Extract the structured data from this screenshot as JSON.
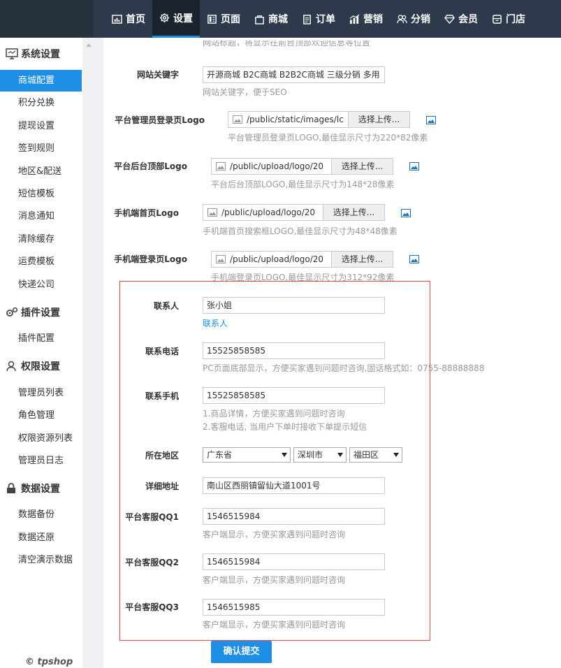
{
  "nav": {
    "items": [
      {
        "label": "首页"
      },
      {
        "label": "设置"
      },
      {
        "label": "页面"
      },
      {
        "label": "商城"
      },
      {
        "label": "订单"
      },
      {
        "label": "营销"
      },
      {
        "label": "分销"
      },
      {
        "label": "会员"
      },
      {
        "label": "门店"
      }
    ],
    "active_index": 1,
    "active_color": "#1e8de0"
  },
  "sidebar": {
    "groups": [
      {
        "title": "系统设置",
        "icon": "monitor-icon"
      },
      {
        "title": "插件设置",
        "icon": "gears-icon"
      },
      {
        "title": "权限设置",
        "icon": "user-icon"
      },
      {
        "title": "数据设置",
        "icon": "lock-icon"
      }
    ],
    "items": [
      "商城配置",
      "积分兑换",
      "提现设置",
      "签到规则",
      "地区&配送",
      "短信模板",
      "消息通知",
      "清除缓存",
      "运费模板",
      "快递公司",
      "插件配置",
      "管理员列表",
      "角色管理",
      "权限资源列表",
      "管理员日志",
      "数据备份",
      "数据还原",
      "清空演示数据"
    ],
    "active_item": "商城配置",
    "copyright": "© tpshop"
  },
  "form": {
    "top_hint_partial": "网站标题，将显示在前台顶部欢迎信息等位置",
    "keywords": {
      "label": "网站关键字",
      "value": "开源商城 B2C商城  B2B2C商城  三级分销  多用",
      "hint": "网站关键字，便于SEO"
    },
    "logos": [
      {
        "label": "平台管理员登录页Logo",
        "path": "/public/static/images/lc",
        "button": "选择上传...",
        "hint": "平台管理员登录页LOGO,最佳显示尺寸为220*82像素"
      },
      {
        "label": "平台后台顶部Logo",
        "path": "/public/upload/logo/20",
        "button": "选择上传...",
        "hint": "平台后台顶部LOGO,最佳显示尺寸为148*28像素"
      },
      {
        "label": "手机端首页Logo",
        "path": "/public/upload/logo/20",
        "button": "选择上传...",
        "hint": "手机端首页搜索框LOGO,最佳显示尺寸为48*48像素"
      },
      {
        "label": "手机端登录页Logo",
        "path": "/public/upload/logo/20",
        "button": "选择上传...",
        "hint": "手机端登录页LOGO,最佳显示尺寸为312*92像素"
      }
    ],
    "contact": {
      "label": "联系人",
      "value": "张小姐",
      "hint": "联系人"
    },
    "phone": {
      "label": "联系电话",
      "value": "15525858585",
      "hint": "PC页面底部显示，方便买家遇到问题时咨询,固话格式如：0755-88888888"
    },
    "mobile": {
      "label": "联系手机",
      "value": "15525858585",
      "hint1": "1.商品详情，方便买家遇到问题时咨询",
      "hint2": "2.客服电话, 当用户下单时接收下单提示短信"
    },
    "region": {
      "label": "所在地区",
      "province": "广东省",
      "city": "深圳市",
      "district": "福田区"
    },
    "address": {
      "label": "详细地址",
      "value": "南山区西丽镇留仙大道1001号"
    },
    "qq1": {
      "label": "平台客服QQ1",
      "value": "1546515984",
      "hint": "客户端显示，方便买家遇到问题时咨询"
    },
    "qq2": {
      "label": "平台客服QQ2",
      "value": "1546515984",
      "hint": "客户端显示，方便买家遇到问题时咨询"
    },
    "qq3": {
      "label": "平台客服QQ3",
      "value": "1546515985",
      "hint": "客户端显示，方便买家遇到问题时咨询"
    },
    "submit": "确认提交"
  },
  "colors": {
    "topbar": "#2d3a4b",
    "accent": "#1f8fe6",
    "highlight_border": "#e0474b"
  }
}
